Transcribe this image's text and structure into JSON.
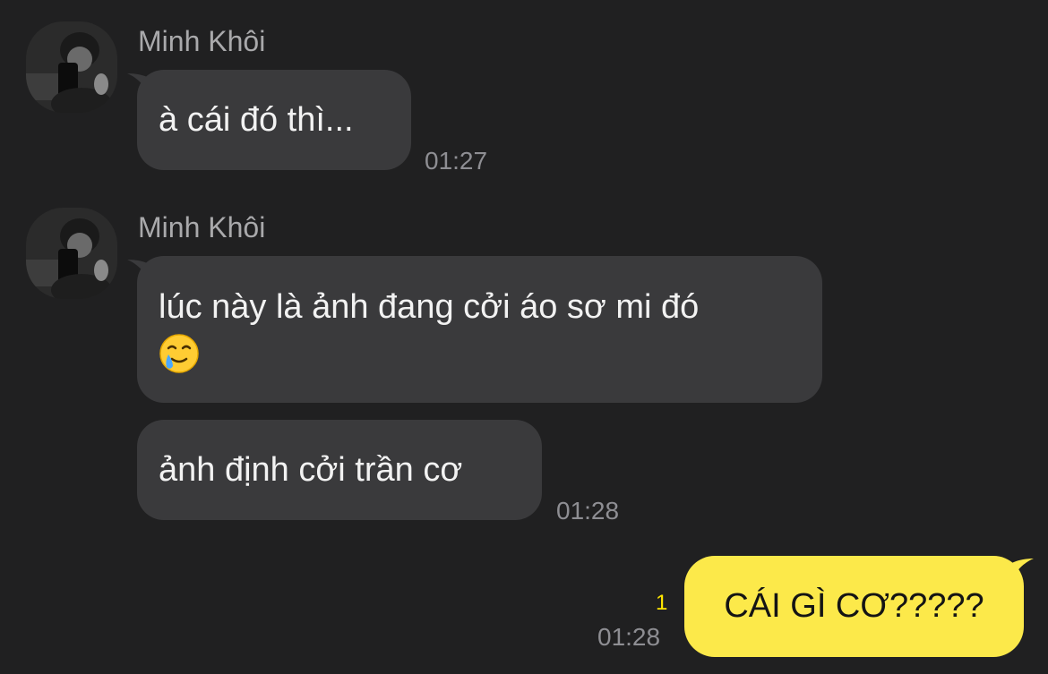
{
  "messages": [
    {
      "sender": "Minh Khôi",
      "bubbles": [
        {
          "text": "à cái đó thì..."
        }
      ],
      "time": "01:27"
    },
    {
      "sender": "Minh Khôi",
      "bubbles": [
        {
          "text": "lúc này là ảnh đang cởi áo sơ mi đó",
          "emoji": "smiling-face-with-tear"
        },
        {
          "text": "ảnh định cởi trần cơ"
        }
      ],
      "time": "01:28"
    }
  ],
  "sent": {
    "text": "CÁI GÌ CƠ?????",
    "unread_count": "1",
    "time": "01:28"
  },
  "colors": {
    "background": "#202021",
    "incoming_bubble": "#3a3a3c",
    "outgoing_bubble": "#fce94a",
    "unread_count": "#ffe600"
  }
}
